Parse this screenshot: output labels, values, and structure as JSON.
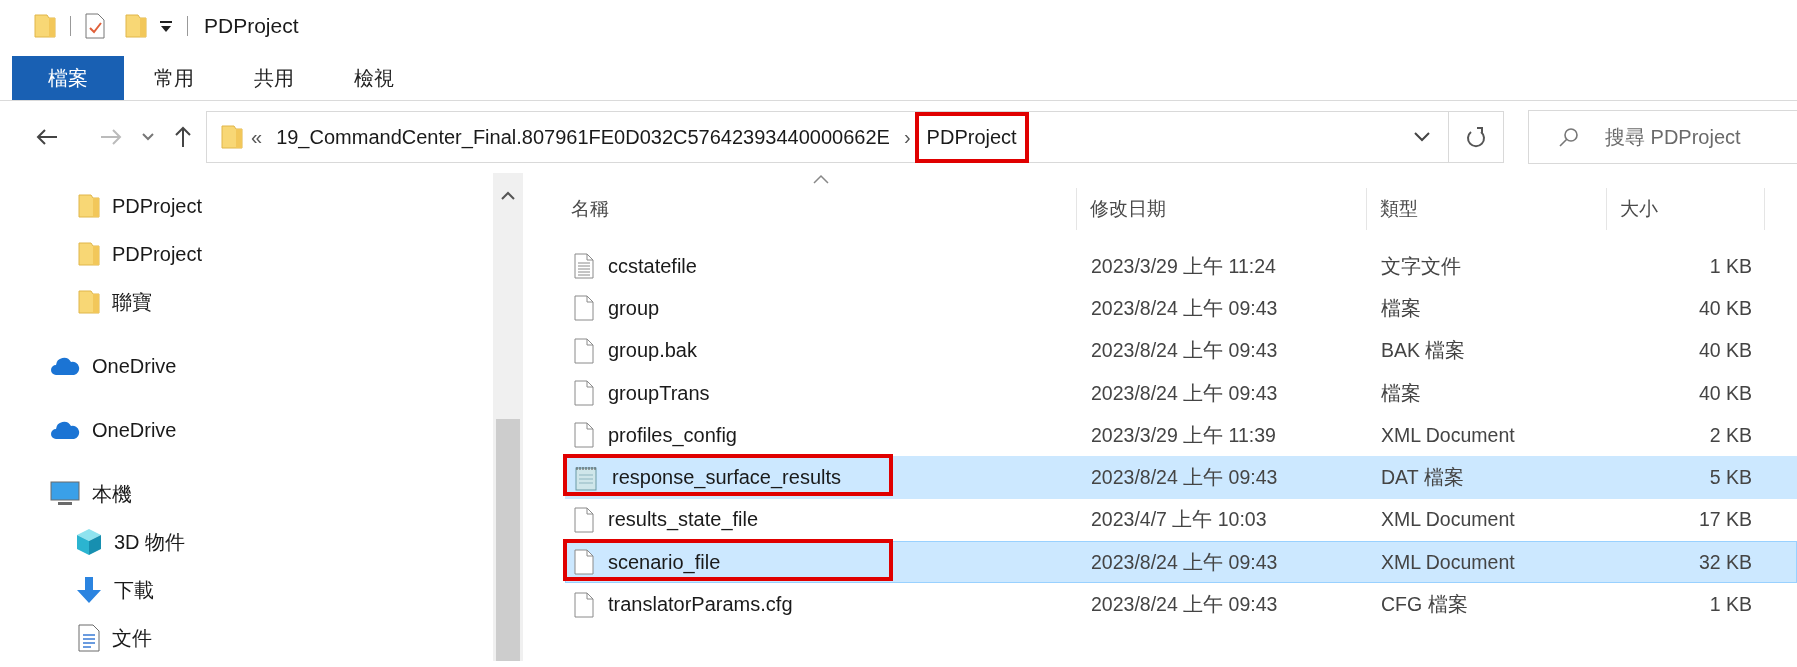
{
  "window": {
    "title": "PDProject"
  },
  "ribbon": {
    "tabs": [
      {
        "label": "檔案",
        "kind": "file_menu"
      },
      {
        "label": "常用",
        "kind": "tab"
      },
      {
        "label": "共用",
        "kind": "tab"
      },
      {
        "label": "檢視",
        "kind": "tab"
      }
    ]
  },
  "address": {
    "overflow_mark": "«",
    "separator": "›",
    "segments": [
      {
        "label": "19_CommandCenter_Final.807961FE0D032C57642393440000662E",
        "annotated": false
      },
      {
        "label": "PDProject",
        "annotated": true
      }
    ]
  },
  "search": {
    "placeholder": "搜尋 PDProject"
  },
  "navigation": {
    "items": [
      {
        "label": "PDProject",
        "kind": "folder"
      },
      {
        "label": "PDProject",
        "kind": "folder"
      },
      {
        "label": "聯寶",
        "kind": "folder"
      },
      {
        "label": "OneDrive",
        "kind": "onedrive"
      },
      {
        "label": "OneDrive",
        "kind": "onedrive"
      },
      {
        "label": "本機",
        "kind": "pc",
        "children": [
          {
            "label": "3D 物件",
            "kind": "objects3d"
          },
          {
            "label": "下載",
            "kind": "downloads"
          },
          {
            "label": "文件",
            "kind": "documents"
          }
        ]
      }
    ]
  },
  "file_list": {
    "columns": [
      "名稱",
      "修改日期",
      "類型",
      "大小"
    ],
    "rows": [
      {
        "kind": "text",
        "name": "ccstatefile",
        "modified": "2023/3/29 上午 11:24",
        "type": "文字文件",
        "size": "1 KB",
        "selected": false,
        "focused": false,
        "annotated": false
      },
      {
        "kind": "file",
        "name": "group",
        "modified": "2023/8/24 上午 09:43",
        "type": "檔案",
        "size": "40 KB",
        "selected": false,
        "focused": false,
        "annotated": false
      },
      {
        "kind": "file",
        "name": "group.bak",
        "modified": "2023/8/24 上午 09:43",
        "type": "BAK 檔案",
        "size": "40 KB",
        "selected": false,
        "focused": false,
        "annotated": false
      },
      {
        "kind": "file",
        "name": "groupTrans",
        "modified": "2023/8/24 上午 09:43",
        "type": "檔案",
        "size": "40 KB",
        "selected": false,
        "focused": false,
        "annotated": false
      },
      {
        "kind": "file",
        "name": "profiles_config",
        "modified": "2023/3/29 上午 11:39",
        "type": "XML Document",
        "size": "2 KB",
        "selected": false,
        "focused": false,
        "annotated": false
      },
      {
        "kind": "notepad",
        "name": "response_surface_results",
        "modified": "2023/8/24 上午 09:43",
        "type": "DAT 檔案",
        "size": "5 KB",
        "selected": true,
        "focused": false,
        "annotated": true
      },
      {
        "kind": "file",
        "name": "results_state_file",
        "modified": "2023/4/7 上午 10:03",
        "type": "XML Document",
        "size": "17 KB",
        "selected": false,
        "focused": false,
        "annotated": false
      },
      {
        "kind": "file",
        "name": "scenario_file",
        "modified": "2023/8/24 上午 09:43",
        "type": "XML Document",
        "size": "32 KB",
        "selected": true,
        "focused": true,
        "annotated": true
      },
      {
        "kind": "file",
        "name": "translatorParams.cfg",
        "modified": "2023/8/24 上午 09:43",
        "type": "CFG 檔案",
        "size": "1 KB",
        "selected": false,
        "focused": false,
        "annotated": false
      }
    ]
  }
}
